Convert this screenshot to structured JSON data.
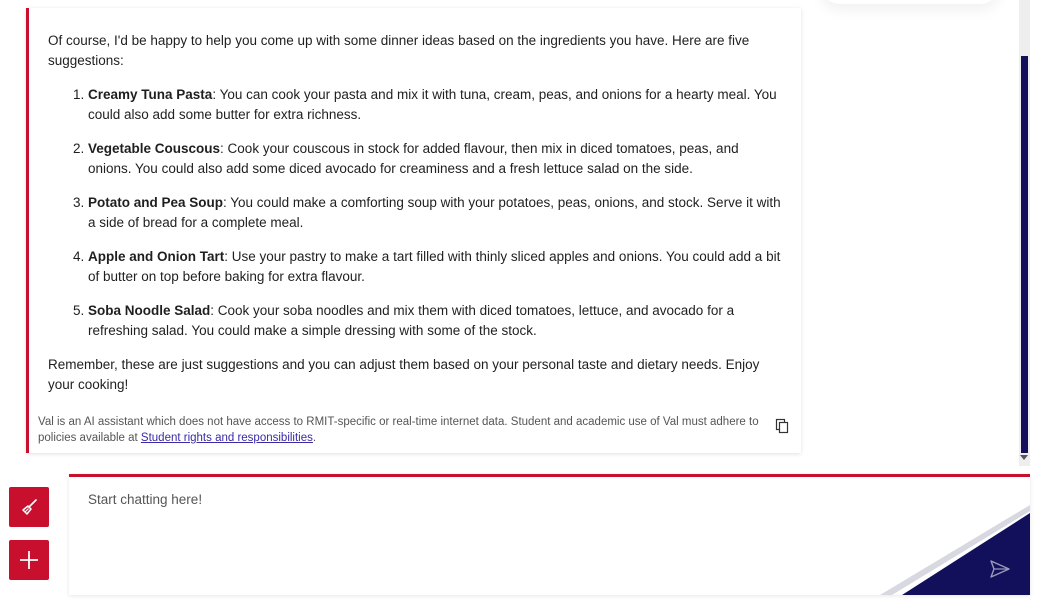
{
  "message": {
    "intro": "Of course, I'd be happy to help you come up with some dinner ideas based on the ingredients you have. Here are five suggestions:",
    "items": [
      {
        "title": "Creamy Tuna Pasta",
        "text": ": You can cook your pasta and mix it with tuna, cream, peas, and onions for a hearty meal. You could also add some butter for extra richness."
      },
      {
        "title": "Vegetable Couscous",
        "text": ": Cook your couscous in stock for added flavour, then mix in diced tomatoes, peas, and onions. You could also add some diced avocado for creaminess and a fresh lettuce salad on the side."
      },
      {
        "title": "Potato and Pea Soup",
        "text": ": You could make a comforting soup with your potatoes, peas, onions, and stock. Serve it with a side of bread for a complete meal."
      },
      {
        "title": "Apple and Onion Tart",
        "text": ": Use your pastry to make a tart filled with thinly sliced apples and onions. You could add a bit of butter on top before baking for extra flavour."
      },
      {
        "title": "Soba Noodle Salad",
        "text": ": Cook your soba noodles and mix them with diced tomatoes, lettuce, and avocado for a refreshing salad. You could make a simple dressing with some of the stock."
      }
    ],
    "outro": "Remember, these are just suggestions and you can adjust them based on your personal taste and dietary needs. Enjoy your cooking!"
  },
  "disclaimer": {
    "text": "Val is an AI assistant which does not have access to RMIT-specific or real-time internet data. Student and academic use of Val must adhere to policies available at ",
    "link": "Student rights and responsibilities",
    "end": "."
  },
  "icons": {
    "copy": "copy-icon",
    "clear": "broom-icon",
    "new_chat": "plus-icon",
    "send": "send-icon"
  },
  "input": {
    "placeholder": "Start chatting here!"
  },
  "colors": {
    "accent_red": "#c8102e",
    "navy": "#12105a"
  }
}
